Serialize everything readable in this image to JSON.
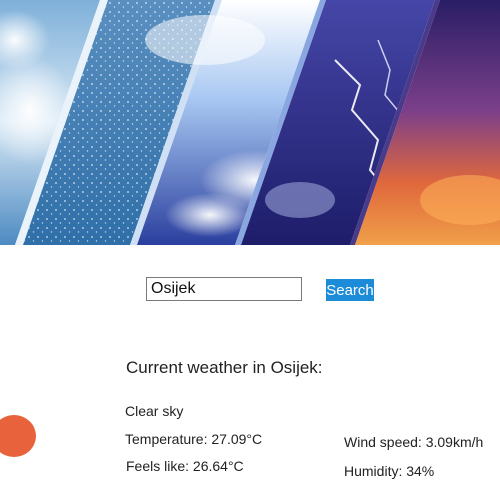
{
  "search": {
    "input_value": "Osijek",
    "button_label": "Search"
  },
  "weather": {
    "heading": "Current weather in Osijek:",
    "description": "Clear sky",
    "temperature": "Temperature: 27.09°C",
    "feels_like": "Feels like: 26.64°C",
    "wind_speed": "Wind speed: 3.09km/h",
    "humidity": "Humidity: 34%"
  },
  "colors": {
    "search_button": "#1d8cd8",
    "accent_dot": "#e8623c"
  }
}
